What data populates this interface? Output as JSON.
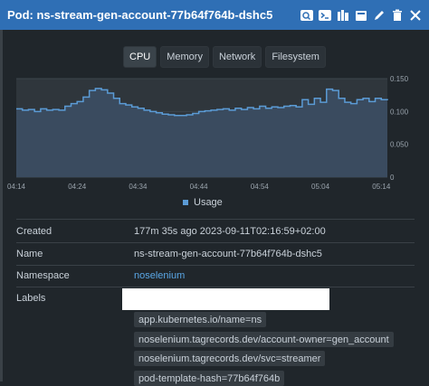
{
  "header": {
    "title": "Pod: ns-stream-gen-account-77b64f764b-dshc5"
  },
  "tabs": [
    {
      "label": "CPU",
      "active": true
    },
    {
      "label": "Memory",
      "active": false
    },
    {
      "label": "Network",
      "active": false
    },
    {
      "label": "Filesystem",
      "active": false
    }
  ],
  "chart_data": {
    "type": "area",
    "x": [
      "04:14",
      "04:15",
      "04:16",
      "04:17",
      "04:18",
      "04:19",
      "04:20",
      "04:21",
      "04:22",
      "04:23",
      "04:24",
      "04:25",
      "04:26",
      "04:27",
      "04:28",
      "04:29",
      "04:30",
      "04:31",
      "04:32",
      "04:33",
      "04:34",
      "04:35",
      "04:36",
      "04:37",
      "04:38",
      "04:39",
      "04:40",
      "04:41",
      "04:42",
      "04:43",
      "04:44",
      "04:45",
      "04:46",
      "04:47",
      "04:48",
      "04:49",
      "04:50",
      "04:51",
      "04:52",
      "04:53",
      "04:54",
      "04:55",
      "04:56",
      "04:57",
      "04:58",
      "04:59",
      "05:00",
      "05:01",
      "05:02",
      "05:03",
      "05:04",
      "05:05",
      "05:06",
      "05:07",
      "05:08",
      "05:09",
      "05:10",
      "05:11",
      "05:12",
      "05:13",
      "05:14",
      "05:15"
    ],
    "series": [
      {
        "name": "Usage",
        "values": [
          0.104,
          0.102,
          0.103,
          0.1,
          0.104,
          0.102,
          0.103,
          0.102,
          0.108,
          0.112,
          0.115,
          0.122,
          0.132,
          0.135,
          0.133,
          0.128,
          0.12,
          0.112,
          0.11,
          0.107,
          0.105,
          0.102,
          0.1,
          0.098,
          0.096,
          0.095,
          0.094,
          0.094,
          0.095,
          0.097,
          0.1,
          0.101,
          0.102,
          0.103,
          0.104,
          0.102,
          0.105,
          0.103,
          0.106,
          0.104,
          0.108,
          0.105,
          0.107,
          0.106,
          0.108,
          0.109,
          0.107,
          0.118,
          0.111,
          0.12,
          0.114,
          0.134,
          0.132,
          0.12,
          0.114,
          0.112,
          0.118,
          0.12,
          0.115,
          0.12,
          0.118,
          0.117
        ]
      }
    ],
    "x_ticks": [
      "04:14",
      "04:24",
      "04:34",
      "04:44",
      "04:54",
      "05:04",
      "05:14"
    ],
    "y_ticks": [
      "0",
      "0.050",
      "0.100",
      "0.150"
    ],
    "ylim": [
      0,
      0.15
    ],
    "grid": true,
    "legend_position": "bottom",
    "colors": {
      "line": "#5b9bd5",
      "fill": "#3a4b5f",
      "plot_bg": "#2f363c",
      "grid": "#3d454c"
    }
  },
  "details": {
    "created_label": "Created",
    "created_value": "177m 35s ago 2023-09-11T02:16:59+02:00",
    "name_label": "Name",
    "name_value": "ns-stream-gen-account-77b64f764b-dshc5",
    "namespace_label": "Namespace",
    "namespace_value": "noselenium",
    "labels_label": "Labels",
    "labels": [
      "app.kubernetes.io/name=ns",
      "noselenium.tagrecords.dev/account-owner=gen_account",
      "noselenium.tagrecords.dev/svc=streamer",
      "pod-template-hash=77b64f764b"
    ]
  },
  "icons": [
    "search-icon",
    "terminal-icon",
    "logs-icon",
    "attach-icon",
    "edit-icon",
    "delete-icon",
    "close-icon"
  ]
}
